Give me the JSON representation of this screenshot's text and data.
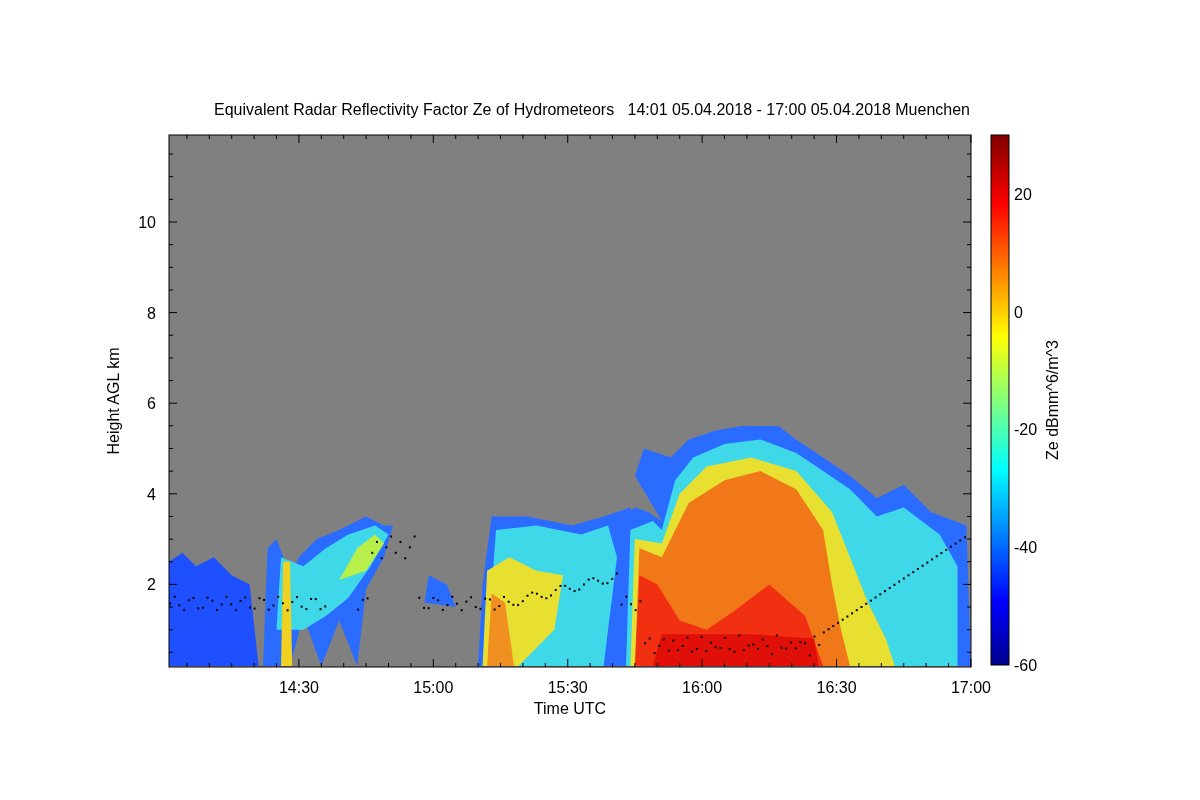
{
  "title": "Equivalent Radar Reflectivity Factor Ze of Hydrometeors   14:01 05.04.2018 - 17:00 05.04.2018 Muenchen",
  "y_axis": {
    "label": "Height AGL km",
    "ticks": [
      "10",
      "8",
      "6",
      "4",
      "2"
    ]
  },
  "x_axis": {
    "label": "Time UTC",
    "ticks": [
      "14:30",
      "15:00",
      "15:30",
      "16:00",
      "16:30",
      "17:00"
    ]
  },
  "colorbar": {
    "label": "Ze dBmm^6/m^3",
    "ticks": [
      "20",
      "0",
      "-20",
      "-40",
      "-60"
    ]
  }
}
